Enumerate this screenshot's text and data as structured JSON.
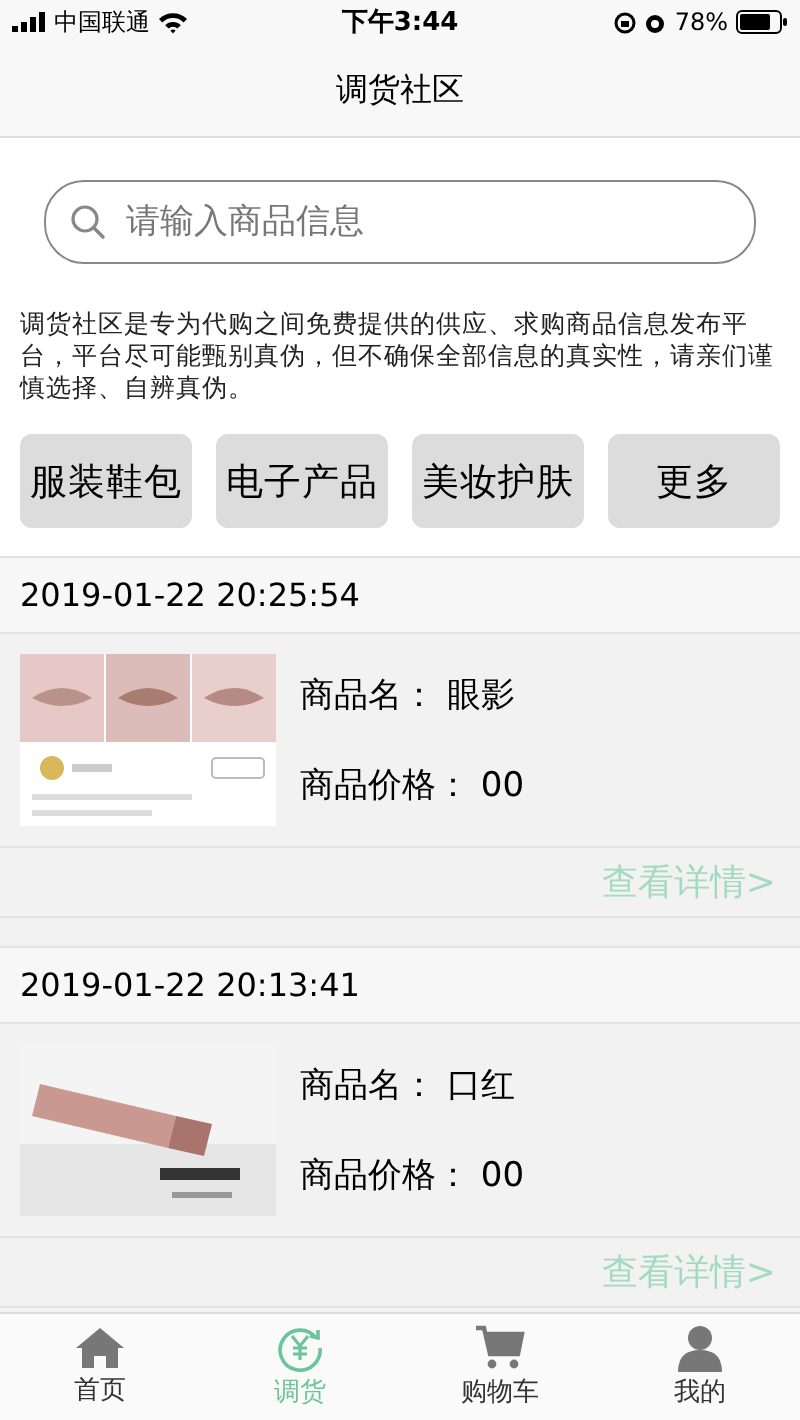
{
  "status_bar": {
    "carrier": "中国联通",
    "time": "下午3:44",
    "battery": "78%"
  },
  "nav": {
    "title": "调货社区"
  },
  "search": {
    "placeholder": "请输入商品信息"
  },
  "notice": "调货社区是专为代购之间免费提供的供应、求购商品信息发布平台，平台尽可能甄别真伪，但不确保全部信息的真实性，请亲们谨慎选择、自辨真伪。",
  "categories": [
    "服装鞋包",
    "电子产品",
    "美妆护肤",
    "更多"
  ],
  "posts": [
    {
      "time": "2019-01-22 20:25:54",
      "name_label": "商品名：",
      "name": "眼影",
      "price_label": "商品价格：",
      "price": "00",
      "link": "查看详情>"
    },
    {
      "time": "2019-01-22 20:13:41",
      "name_label": "商品名：",
      "name": "口红",
      "price_label": "商品价格：",
      "price": "00",
      "link": "查看详情>"
    }
  ],
  "tab_bar": [
    {
      "label": "首页",
      "selected": false
    },
    {
      "label": "调货",
      "selected": true
    },
    {
      "label": "购物车",
      "selected": false
    },
    {
      "label": "我的",
      "selected": false
    }
  ]
}
